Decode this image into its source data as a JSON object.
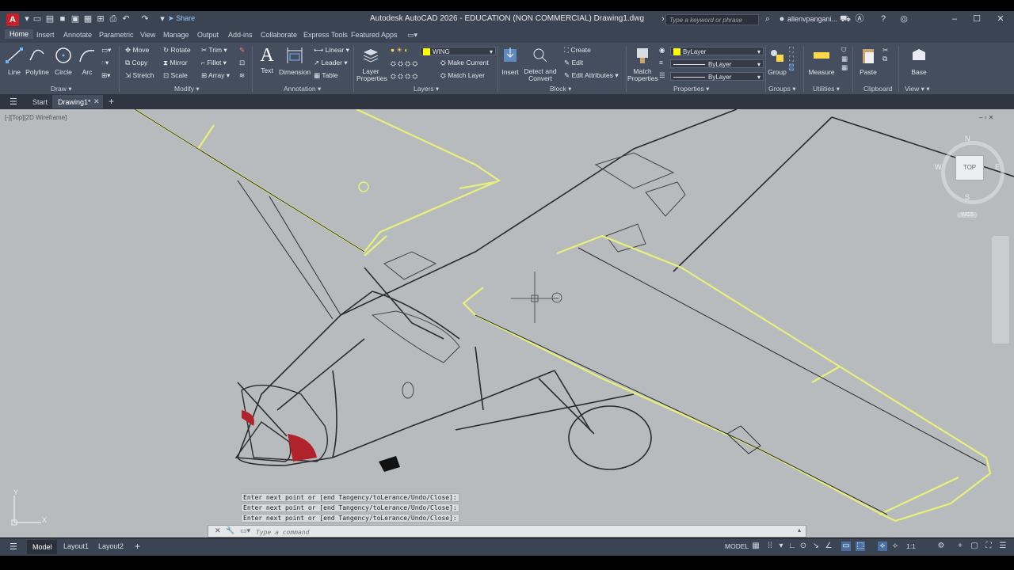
{
  "titlebar": {
    "title": "Autodesk AutoCAD 2026 - EDUCATION (NON COMMERCIAL)    Drawing1.dwg",
    "share_label": "Share",
    "search_placeholder": "Type a keyword or phrase",
    "user": "allenvpangani..."
  },
  "tabs": [
    "Home",
    "Insert",
    "Annotate",
    "Parametric",
    "View",
    "Manage",
    "Output",
    "Add-ins",
    "Collaborate",
    "Express Tools",
    "Featured Apps"
  ],
  "ribbon": {
    "draw": {
      "title": "Draw",
      "line": "Line",
      "polyline": "Polyline",
      "circle": "Circle",
      "arc": "Arc"
    },
    "modify": {
      "title": "Modify",
      "move": "Move",
      "rotate": "Rotate",
      "trim": "Trim",
      "copy": "Copy",
      "mirror": "Mirror",
      "fillet": "Fillet",
      "stretch": "Stretch",
      "scale": "Scale",
      "array": "Array"
    },
    "annotation": {
      "title": "Annotation",
      "text": "Text",
      "dimension": "Dimension",
      "linear": "Linear",
      "leader": "Leader",
      "table": "Table"
    },
    "layers": {
      "title": "Layers",
      "layer_properties": "Layer Properties",
      "current_layer": "WING",
      "make_current": "Make Current",
      "match_layer": "Match Layer"
    },
    "block": {
      "title": "Block",
      "insert": "Insert",
      "detect_convert": "Detect and Convert",
      "create": "Create",
      "edit": "Edit",
      "edit_attributes": "Edit Attributes"
    },
    "properties": {
      "title": "Properties",
      "match_properties": "Match Properties",
      "color": "ByLayer",
      "linetype": "ByLayer",
      "lineweight": "ByLayer"
    },
    "groups": {
      "title": "Groups",
      "group": "Group"
    },
    "utilities": {
      "title": "Utilities",
      "measure": "Measure"
    },
    "clipboard": {
      "title": "Clipboard",
      "paste": "Paste"
    },
    "view": {
      "title": "View",
      "base": "Base"
    }
  },
  "doctabs": {
    "start": "Start",
    "drawing": "Drawing1*"
  },
  "viewport": {
    "label": "[-][Top][2D Wireframe]",
    "viewcube": {
      "face": "TOP",
      "n": "N",
      "s": "S",
      "e": "E",
      "w": "W",
      "wcs": "WCS"
    },
    "ucs": {
      "x": "X",
      "y": "Y"
    }
  },
  "command": {
    "history": [
      "Enter next point or [end Tangency/toLerance/Undo/Close]:",
      "Enter next point or [end Tangency/toLerance/Undo/Close]:",
      "Enter next point or [end Tangency/toLerance/Undo/Close]:"
    ],
    "placeholder": "Type a command"
  },
  "status": {
    "model": "Model",
    "layout1": "Layout1",
    "layout2": "Layout2",
    "mode": "MODEL",
    "scale": "1:1"
  },
  "colors": {
    "wing_layer": "#ffff00",
    "highlight": "#e8f07a",
    "ribbon": "#454e5e",
    "titlebar": "#3b4453",
    "viewport": "#b8bbbe",
    "prop_red": "#b0232b"
  }
}
